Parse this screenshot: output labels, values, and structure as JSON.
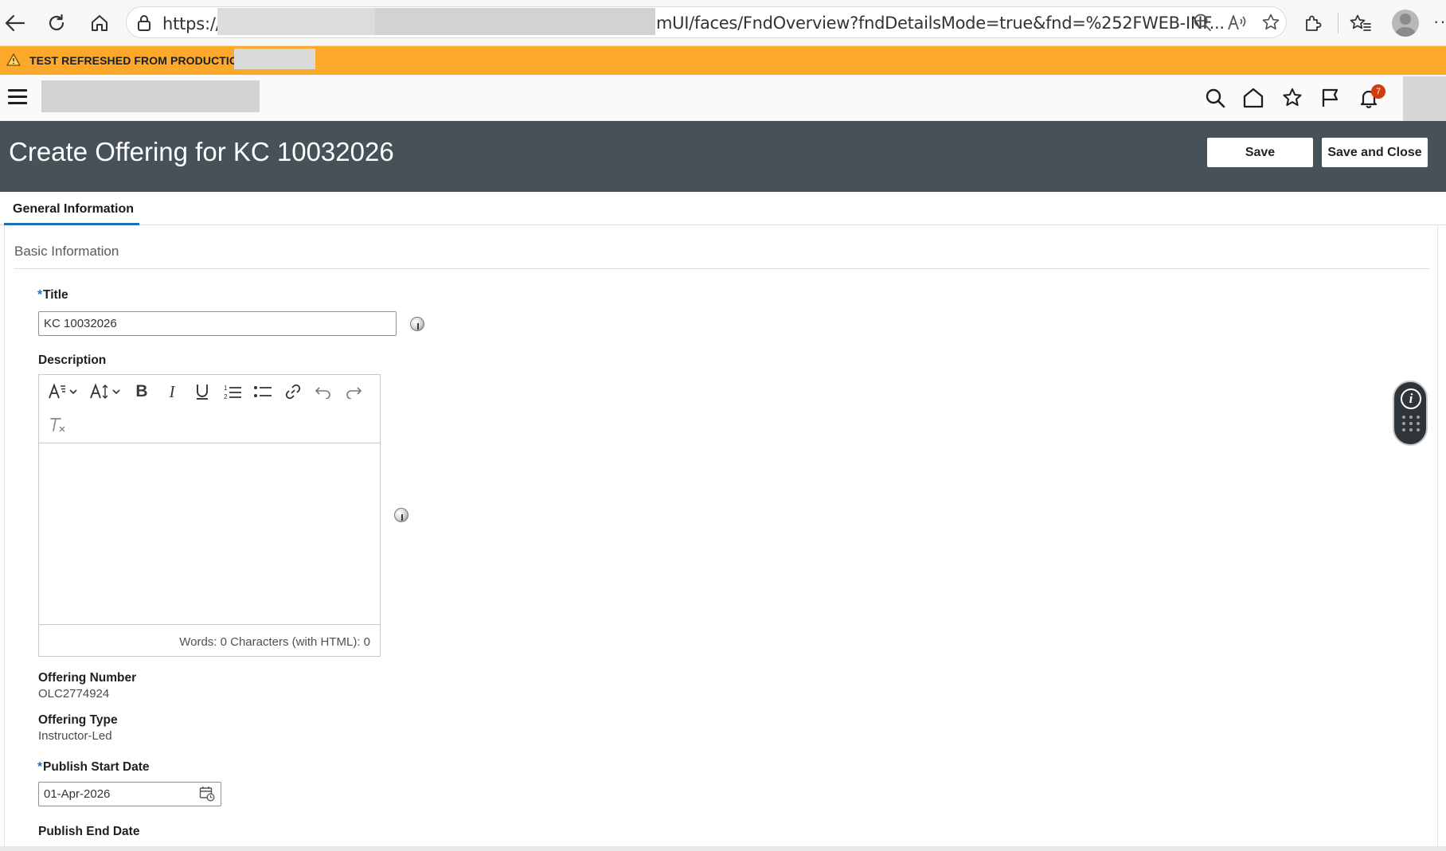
{
  "browser": {
    "url_start": "https://",
    "url_end": "mUI/faces/FndOverview?fndDetailsMode=true&fnd=%252FWEB-INF...",
    "more_label": "···"
  },
  "banner": {
    "text": "TEST REFRESHED FROM PRODUCTION"
  },
  "global_header": {
    "notification_count": "7"
  },
  "page": {
    "title": "Create Offering for KC 10032026",
    "save_label": "Save",
    "save_close_label": "Save and Close"
  },
  "tabs": [
    {
      "label": "General Information",
      "active": true
    }
  ],
  "section": {
    "title": "Basic Information"
  },
  "form": {
    "title_label": "Title",
    "title_value": "KC 10032026",
    "description_label": "Description",
    "description_value": "",
    "editor_counter": "Words: 0  Characters (with HTML): 0",
    "offering_number_label": "Offering Number",
    "offering_number_value": "OLC2774924",
    "offering_type_label": "Offering Type",
    "offering_type_value": "Instructor-Led",
    "publish_start_label": "Publish Start Date",
    "publish_start_value": "01-Apr-2026",
    "publish_end_label": "Publish End Date"
  },
  "colors": {
    "banner": "#fca82a",
    "page_header": "#465158",
    "tab_accent": "#1f6fba",
    "notification_badge": "#d33b0c"
  },
  "icons": {
    "back": "back-arrow-icon",
    "refresh": "refresh-icon",
    "home": "home-icon",
    "lock": "lock-icon",
    "zoom": "zoom-out-icon",
    "read_aloud": "read-aloud-icon",
    "favorite": "star-icon",
    "extensions": "puzzle-icon",
    "favorites_bar": "favorites-icon",
    "warning": "warning-icon",
    "menu": "hamburger-icon",
    "search": "search-icon",
    "flag": "flag-icon",
    "bell": "bell-icon",
    "calendar": "calendar-icon",
    "help": "help-icon",
    "info": "info-icon",
    "grid": "grid-icon"
  }
}
